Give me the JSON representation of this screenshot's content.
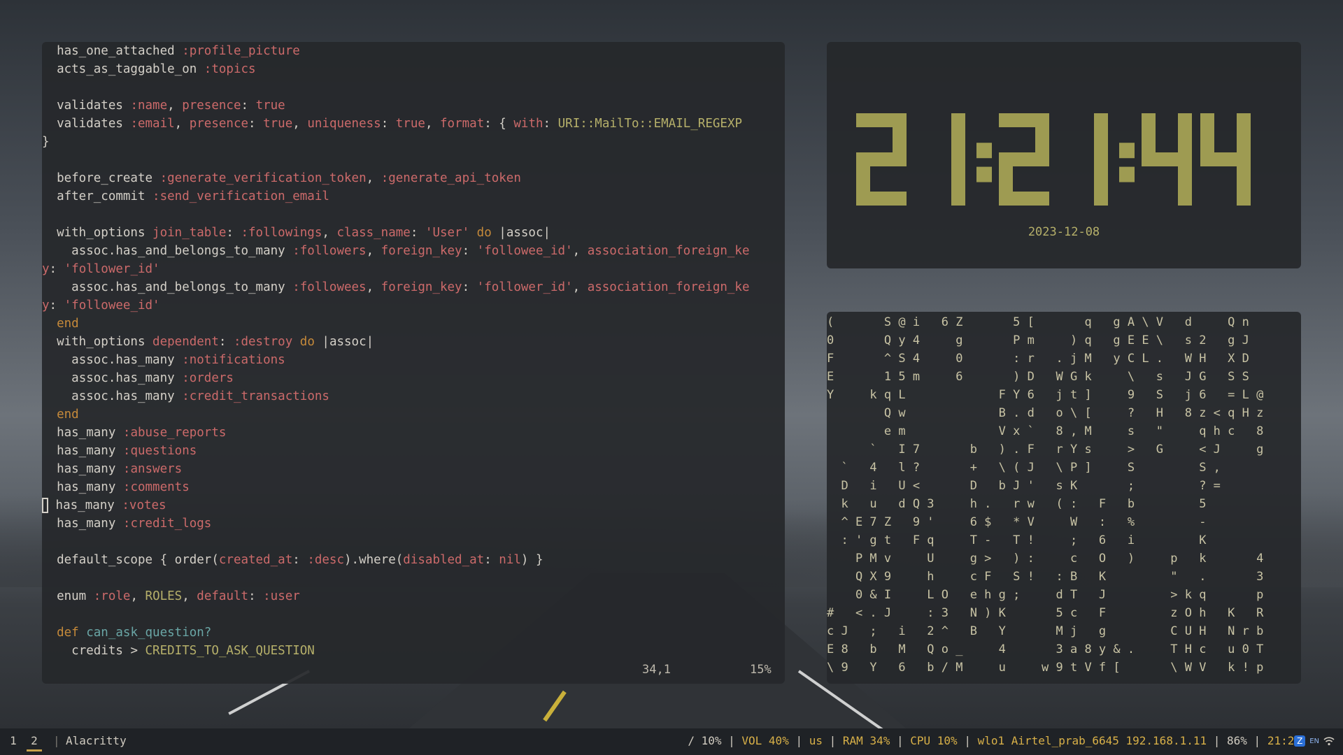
{
  "editor": {
    "lines": [
      {
        "indent": "  ",
        "segs": [
          [
            "t",
            "has_one_attached "
          ],
          [
            "sym",
            ":profile_picture"
          ]
        ]
      },
      {
        "indent": "  ",
        "segs": [
          [
            "t",
            "acts_as_taggable_on "
          ],
          [
            "sym",
            ":topics"
          ]
        ]
      },
      {
        "indent": "",
        "segs": []
      },
      {
        "indent": "  ",
        "segs": [
          [
            "t",
            "validates "
          ],
          [
            "sym",
            ":name"
          ],
          [
            "t",
            ", "
          ],
          [
            "key",
            "presence"
          ],
          [
            "t",
            ": "
          ],
          [
            "bool",
            "true"
          ]
        ]
      },
      {
        "indent": "  ",
        "segs": [
          [
            "t",
            "validates "
          ],
          [
            "sym",
            ":email"
          ],
          [
            "t",
            ", "
          ],
          [
            "key",
            "presence"
          ],
          [
            "t",
            ": "
          ],
          [
            "bool",
            "true"
          ],
          [
            "t",
            ", "
          ],
          [
            "key",
            "uniqueness"
          ],
          [
            "t",
            ": "
          ],
          [
            "bool",
            "true"
          ],
          [
            "t",
            ", "
          ],
          [
            "key",
            "format"
          ],
          [
            "t",
            ": { "
          ],
          [
            "key",
            "with"
          ],
          [
            "t",
            ": "
          ],
          [
            "const",
            "URI::MailTo::EMAIL_REGEXP"
          ]
        ]
      },
      {
        "indent": "",
        "segs": [
          [
            "t",
            "}"
          ]
        ]
      },
      {
        "indent": "",
        "segs": []
      },
      {
        "indent": "  ",
        "segs": [
          [
            "t",
            "before_create "
          ],
          [
            "sym",
            ":generate_verification_token"
          ],
          [
            "t",
            ", "
          ],
          [
            "sym",
            ":generate_api_token"
          ]
        ]
      },
      {
        "indent": "  ",
        "segs": [
          [
            "t",
            "after_commit "
          ],
          [
            "sym",
            ":send_verification_email"
          ]
        ]
      },
      {
        "indent": "",
        "segs": []
      },
      {
        "indent": "  ",
        "segs": [
          [
            "t",
            "with_options "
          ],
          [
            "key",
            "join_table"
          ],
          [
            "t",
            ": "
          ],
          [
            "sym",
            ":followings"
          ],
          [
            "t",
            ", "
          ],
          [
            "key",
            "class_name"
          ],
          [
            "t",
            ": "
          ],
          [
            "str",
            "'User'"
          ],
          [
            "t",
            " "
          ],
          [
            "kw",
            "do"
          ],
          [
            "t",
            " |assoc|"
          ]
        ]
      },
      {
        "indent": "    ",
        "segs": [
          [
            "t",
            "assoc.has_and_belongs_to_many "
          ],
          [
            "sym",
            ":followers"
          ],
          [
            "t",
            ", "
          ],
          [
            "key",
            "foreign_key"
          ],
          [
            "t",
            ": "
          ],
          [
            "str",
            "'followee_id'"
          ],
          [
            "t",
            ", "
          ],
          [
            "key",
            "association_foreign_ke"
          ]
        ]
      },
      {
        "indent": "",
        "segs": [
          [
            "key",
            "y"
          ],
          [
            "t",
            ": "
          ],
          [
            "str",
            "'follower_id'"
          ]
        ]
      },
      {
        "indent": "    ",
        "segs": [
          [
            "t",
            "assoc.has_and_belongs_to_many "
          ],
          [
            "sym",
            ":followees"
          ],
          [
            "t",
            ", "
          ],
          [
            "key",
            "foreign_key"
          ],
          [
            "t",
            ": "
          ],
          [
            "str",
            "'follower_id'"
          ],
          [
            "t",
            ", "
          ],
          [
            "key",
            "association_foreign_ke"
          ]
        ]
      },
      {
        "indent": "",
        "segs": [
          [
            "key",
            "y"
          ],
          [
            "t",
            ": "
          ],
          [
            "str",
            "'followee_id'"
          ]
        ]
      },
      {
        "indent": "  ",
        "segs": [
          [
            "kw",
            "end"
          ]
        ]
      },
      {
        "indent": "  ",
        "segs": [
          [
            "t",
            "with_options "
          ],
          [
            "key",
            "dependent"
          ],
          [
            "t",
            ": "
          ],
          [
            "sym",
            ":destroy"
          ],
          [
            "t",
            " "
          ],
          [
            "kw",
            "do"
          ],
          [
            "t",
            " |assoc|"
          ]
        ]
      },
      {
        "indent": "    ",
        "segs": [
          [
            "t",
            "assoc.has_many "
          ],
          [
            "sym",
            ":notifications"
          ]
        ]
      },
      {
        "indent": "    ",
        "segs": [
          [
            "t",
            "assoc.has_many "
          ],
          [
            "sym",
            ":orders"
          ]
        ]
      },
      {
        "indent": "    ",
        "segs": [
          [
            "t",
            "assoc.has_many "
          ],
          [
            "sym",
            ":credit_transactions"
          ]
        ]
      },
      {
        "indent": "  ",
        "segs": [
          [
            "kw",
            "end"
          ]
        ]
      },
      {
        "indent": "  ",
        "segs": [
          [
            "t",
            "has_many "
          ],
          [
            "sym",
            ":abuse_reports"
          ]
        ]
      },
      {
        "indent": "  ",
        "segs": [
          [
            "t",
            "has_many "
          ],
          [
            "sym",
            ":questions"
          ]
        ]
      },
      {
        "indent": "  ",
        "segs": [
          [
            "t",
            "has_many "
          ],
          [
            "sym",
            ":answers"
          ]
        ]
      },
      {
        "indent": "  ",
        "segs": [
          [
            "t",
            "has_many "
          ],
          [
            "sym",
            ":comments"
          ]
        ]
      },
      {
        "indent": "  ",
        "cursor": true,
        "segs": [
          [
            "t",
            "has_many "
          ],
          [
            "sym",
            ":votes"
          ]
        ]
      },
      {
        "indent": "  ",
        "segs": [
          [
            "t",
            "has_many "
          ],
          [
            "sym",
            ":credit_logs"
          ]
        ]
      },
      {
        "indent": "",
        "segs": []
      },
      {
        "indent": "  ",
        "segs": [
          [
            "t",
            "default_scope { order("
          ],
          [
            "key",
            "created_at"
          ],
          [
            "t",
            ": "
          ],
          [
            "sym",
            ":desc"
          ],
          [
            "t",
            ").where("
          ],
          [
            "key",
            "disabled_at"
          ],
          [
            "t",
            ": "
          ],
          [
            "bool",
            "nil"
          ],
          [
            "t",
            ") }"
          ]
        ]
      },
      {
        "indent": "",
        "segs": []
      },
      {
        "indent": "  ",
        "segs": [
          [
            "t",
            "enum "
          ],
          [
            "sym",
            ":role"
          ],
          [
            "t",
            ", "
          ],
          [
            "const",
            "ROLES"
          ],
          [
            "t",
            ", "
          ],
          [
            "key",
            "default"
          ],
          [
            "t",
            ": "
          ],
          [
            "sym",
            ":user"
          ]
        ]
      },
      {
        "indent": "",
        "segs": []
      },
      {
        "indent": "  ",
        "segs": [
          [
            "kw",
            "def"
          ],
          [
            "t",
            " "
          ],
          [
            "def",
            "can_ask_question?"
          ]
        ]
      },
      {
        "indent": "    ",
        "segs": [
          [
            "t",
            "credits > "
          ],
          [
            "const",
            "CREDITS_TO_ASK_QUESTION"
          ]
        ]
      }
    ],
    "status_position": "34,1",
    "status_percent": "15%"
  },
  "clock": {
    "time": "21:21:44",
    "date": "2023-12-08",
    "digit_color": "#9e9b52"
  },
  "matrix": {
    "rows": [
      "(       S @ i   6 Z       5 [       q   g A \\ V   d     Q n",
      "0       Q y 4     g       P m     ) q   g E E \\   s 2   g J",
      "F       ^ S 4     0       : r   . j M   y C L .   W H   X D",
      "E       1 5 m     6       ) D   W G k     \\   s   J G   S S",
      "Y     k q L             F Y 6   j t ]     9   S   j 6   = L @",
      "        Q w             B . d   o \\ [     ?   H   8 z < q H z",
      "        e m             V x `   8 , M     s   \"     q h c   8",
      "      `   I 7       b   ) . F   r Y s     >   G     < J     g",
      "  `   4   l ?       +   \\ ( J   \\ P ]     S         S ,",
      "  D   i   U <       D   b J '   s K       ;         ? =",
      "  k   u   d Q 3     h .   r w   ( :   F   b         5",
      "  ^ E 7 Z   9 '     6 $   * V     W   :   %         -",
      "  : ' g t   F q     T -   T !     ;   6   i         K",
      "    P M v     U     g >   ) :     c   O   )     p   k       4",
      "    Q X 9     h     c F   S !   : B   K         \"   .       3",
      "    0 & I     L O   e h g ;     d T   J         > k q       p",
      "#   < . J     : 3   N ) K       5 c   F         z O h   K   R",
      "c J   ;   i   2 ^   B   Y       M j   g         C U H   N r b",
      "E 8   b   M   Q o _     4       3 a 8 y & .     T H c   u 0 T",
      "\\ 9   Y   6   b / M     u     w 9 t V f [       \\ W V   k ! p"
    ]
  },
  "bar": {
    "workspaces": [
      "1",
      "2"
    ],
    "active_workspace": "2",
    "separator": "|",
    "window_title": "Alacritty",
    "status": [
      {
        "text": "/ 10%",
        "hl": false
      },
      {
        "text": " | ",
        "hl": false
      },
      {
        "text": "VOL 40%",
        "hl": true
      },
      {
        "text": " | ",
        "hl": false
      },
      {
        "text": "us",
        "hl": true
      },
      {
        "text": " | ",
        "hl": false
      },
      {
        "text": "RAM 34%",
        "hl": true
      },
      {
        "text": " | ",
        "hl": false
      },
      {
        "text": "CPU 10%",
        "hl": true
      },
      {
        "text": " | ",
        "hl": false
      },
      {
        "text": "wlo1 Airtel_prab_6645 192.168.1.11",
        "hl": true
      },
      {
        "text": " | ",
        "hl": false
      },
      {
        "text": "86%",
        "hl": false
      },
      {
        "text": " | ",
        "hl": false
      },
      {
        "text": "21:21",
        "hl": true
      }
    ],
    "tray": {
      "zulip": "Z",
      "lang": "EN",
      "wifi_icon": "wifi-icon"
    }
  }
}
